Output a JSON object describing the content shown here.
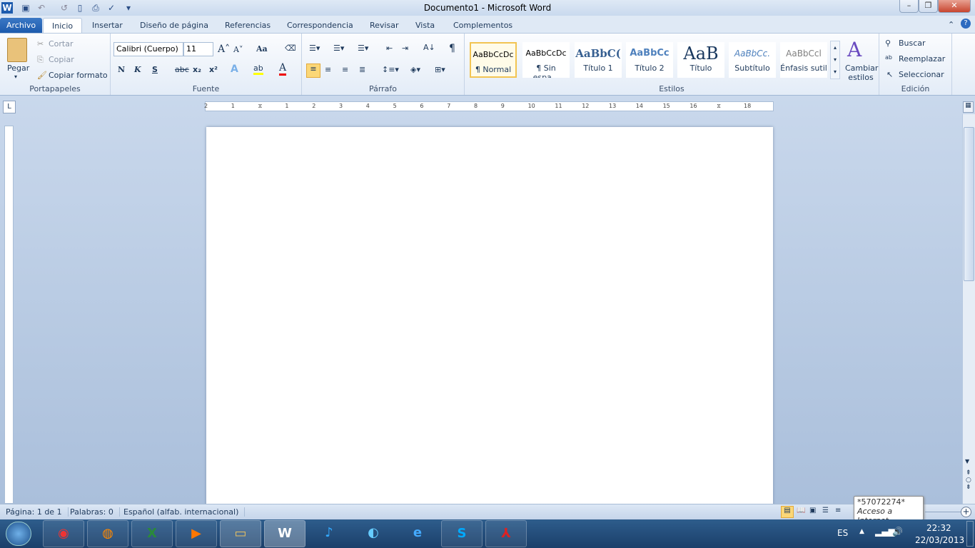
{
  "title": "Documento1  -  Microsoft Word",
  "quick_access": {
    "icons": [
      "word-icon",
      "save-icon",
      "undo-icon",
      "redo-icon",
      "new-document-icon",
      "print-preview-icon",
      "spelling-icon",
      "customize-icon"
    ]
  },
  "tabs": [
    "Archivo",
    "Inicio",
    "Insertar",
    "Diseño de página",
    "Referencias",
    "Correspondencia",
    "Revisar",
    "Vista",
    "Complementos"
  ],
  "clipboard": {
    "paste": "Pegar",
    "cut": "Cortar",
    "copy": "Copiar",
    "format_painter": "Copiar formato",
    "label": "Portapapeles"
  },
  "font": {
    "name": "Calibri (Cuerpo)",
    "size": "11",
    "bold": "N",
    "italic": "K",
    "underline": "S",
    "strike": "abc",
    "sub": "x₂",
    "sup": "x²",
    "case": "Aa",
    "label": "Fuente",
    "highlight_color": "#ffff00",
    "font_color": "#ff0000"
  },
  "paragraph": {
    "label": "Párrafo",
    "pilcrow": "¶"
  },
  "styles": {
    "label": "Estilos",
    "items": [
      {
        "preview": "AaBbCcDc",
        "name": "¶ Normal"
      },
      {
        "preview": "AaBbCcDc",
        "name": "¶ Sin espa..."
      },
      {
        "preview": "AaBbC(",
        "name": "Título 1"
      },
      {
        "preview": "AaBbCc",
        "name": "Título 2"
      },
      {
        "preview": "AaB",
        "name": "Título"
      },
      {
        "preview": "AaBbCc.",
        "name": "Subtítulo"
      },
      {
        "preview": "AaBbCcl",
        "name": "Énfasis sutil"
      }
    ],
    "change": "Cambiar estilos"
  },
  "editing": {
    "label": "Edición",
    "find": "Buscar",
    "replace": "Reemplazar",
    "select": "Seleccionar"
  },
  "ruler": {
    "ticks": [
      "2",
      "1",
      "",
      "1",
      "2",
      "3",
      "4",
      "5",
      "6",
      "7",
      "8",
      "9",
      "10",
      "11",
      "12",
      "13",
      "14",
      "15",
      "16",
      "",
      "18"
    ]
  },
  "status": {
    "page": "Página: 1 de 1",
    "words": "Palabras: 0",
    "language": "Español (alfab. internacional)"
  },
  "tooltip": {
    "line1": "*57072274*",
    "line2": "Acceso a Internet"
  },
  "taskbar": {
    "apps": [
      "Chrome",
      "Firefox",
      "Excel",
      "Media",
      "Explorer",
      "Word",
      "App",
      "Browser",
      "Internet Explorer",
      "Skype",
      "Adobe Reader"
    ],
    "lang": "ES",
    "time": "22:32",
    "date": "22/03/2013"
  }
}
